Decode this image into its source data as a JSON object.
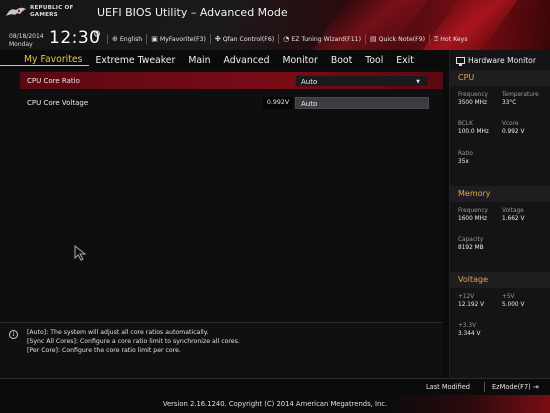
{
  "header": {
    "brand_line1": "REPUBLIC OF",
    "brand_line2": "GAMERS",
    "title": "UEFI BIOS Utility – Advanced Mode",
    "date": "08/18/2014",
    "weekday": "Monday",
    "time": "12:30",
    "toolbar": [
      {
        "icon": "globe-icon",
        "label": "English"
      },
      {
        "icon": "favorite-icon",
        "label": "MyFavorite(F3)"
      },
      {
        "icon": "fan-icon",
        "label": "Qfan Control(F6)"
      },
      {
        "icon": "wizard-icon",
        "label": "EZ Tuning Wizard(F11)"
      },
      {
        "icon": "note-icon",
        "label": "Quick Note(F9)"
      },
      {
        "icon": "question-icon",
        "label": "Hot Keys"
      }
    ]
  },
  "nav": {
    "tabs": [
      "My Favorites",
      "Extreme Tweaker",
      "Main",
      "Advanced",
      "Monitor",
      "Boot",
      "Tool",
      "Exit"
    ],
    "active": "My Favorites"
  },
  "settings": [
    {
      "label": "CPU Core Ratio",
      "value": "Auto",
      "control": "dropdown"
    },
    {
      "label": "CPU Core Voltage",
      "current": "0.992V",
      "value": "Auto",
      "control": "text"
    }
  ],
  "help": {
    "lines": [
      "[Auto]: The system will adjust all core ratios automatically.",
      "[Sync All Cores]: Configure a core ratio limit to synchronize all cores.",
      "[Per Core]: Configure the core ratio limit per core."
    ]
  },
  "hardware_monitor": {
    "title": "Hardware Monitor",
    "cpu": {
      "heading": "CPU",
      "frequency_label": "Frequency",
      "frequency": "3500 MHz",
      "temperature_label": "Temperature",
      "temperature": "33°C",
      "bclk_label": "BCLK",
      "bclk": "100.0 MHz",
      "vcore_label": "Vcore",
      "vcore": "0.992 V",
      "ratio_label": "Ratio",
      "ratio": "35x"
    },
    "memory": {
      "heading": "Memory",
      "frequency_label": "Frequency",
      "frequency": "1600 MHz",
      "voltage_label": "Voltage",
      "voltage": "1.662 V",
      "capacity_label": "Capacity",
      "capacity": "8192 MB"
    },
    "voltage": {
      "heading": "Voltage",
      "v12_label": "+12V",
      "v12": "12.192 V",
      "v5_label": "+5V",
      "v5": "5.000 V",
      "v33_label": "+3.3V",
      "v33": "3.344 V"
    }
  },
  "footer": {
    "last_modified": "Last Modified",
    "ezmode": "EzMode(F7)",
    "copyright": "Version 2.16.1240. Copyright (C) 2014 American Megatrends, Inc."
  },
  "colors": {
    "accent_red": "#7a0c14",
    "active_tab": "#e6c44a",
    "section_heading": "#e6a54a"
  }
}
